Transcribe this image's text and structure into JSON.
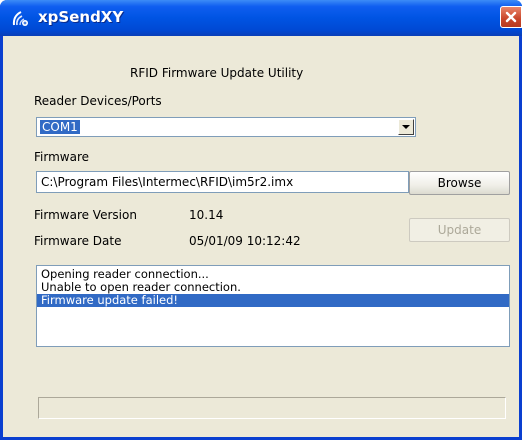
{
  "window": {
    "title": "xpSendXY",
    "heading": "RFID Firmware Update Utility"
  },
  "reader": {
    "label": "Reader Devices/Ports",
    "selected_port": "COM1"
  },
  "firmware": {
    "label": "Firmware",
    "path": "C:\\Program Files\\Intermec\\RFID\\im5r2.imx",
    "browse_label": "Browse",
    "version_label": "Firmware Version",
    "version_value": "10.14",
    "date_label": "Firmware Date",
    "date_value": "05/01/09 10:12:42",
    "update_label": "Update"
  },
  "log": {
    "lines": [
      "Opening reader connection...",
      "Unable to open reader connection.",
      "Firmware update failed!"
    ]
  },
  "colors": {
    "titlebar": "#0054e3",
    "window_bg": "#ece9d8",
    "selection": "#316ac5",
    "close_button": "#c8452a"
  }
}
